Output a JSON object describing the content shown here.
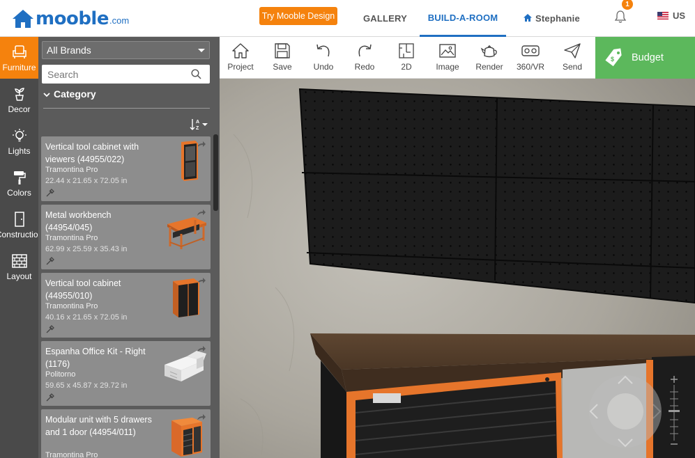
{
  "header": {
    "logo_text": "mooble",
    "logo_suffix": ".com",
    "try_button": "Try Mooble Design",
    "nav": {
      "gallery": "GALLERY",
      "build": "BUILD-A-ROOM",
      "user": "Stephanie"
    },
    "notifications_count": "1",
    "language": "US"
  },
  "sidebar": {
    "items": [
      {
        "label": "Furniture",
        "icon": "armchair-icon",
        "active": true
      },
      {
        "label": "Decor",
        "icon": "plant-icon"
      },
      {
        "label": "Lights",
        "icon": "bulb-icon"
      },
      {
        "label": "Colors",
        "icon": "paint-roller-icon"
      },
      {
        "label": "Construction",
        "icon": "door-icon"
      },
      {
        "label": "Layout",
        "icon": "brick-wall-icon"
      }
    ]
  },
  "catalog": {
    "brand_filter": "All Brands",
    "search_placeholder": "Search",
    "category_label": "Category",
    "items": [
      {
        "title": "Vertical tool cabinet with viewers (44955/022)",
        "brand": "Tramontina Pro",
        "dims": "22.44 x 21.65 x 72.05 in"
      },
      {
        "title": "Metal workbench (44954/045)",
        "brand": "Tramontina Pro",
        "dims": "62.99 x 25.59 x 35.43 in"
      },
      {
        "title": "Vertical tool cabinet (44955/010)",
        "brand": "Tramontina Pro",
        "dims": "40.16 x 21.65 x 72.05 in"
      },
      {
        "title": "Espanha Office Kit - Right (1176)",
        "brand": "Politorno",
        "dims": "59.65 x 45.87 x 29.72 in"
      },
      {
        "title": "Modular unit with 5 drawers and 1 door (44954/011)",
        "brand": "Tramontina Pro",
        "dims": ""
      }
    ]
  },
  "toolbar": {
    "project": "Project",
    "save": "Save",
    "undo": "Undo",
    "redo": "Redo",
    "two_d": "2D",
    "image": "Image",
    "render": "Render",
    "vr": "360/VR",
    "send": "Send",
    "budget": "Budget"
  },
  "colors": {
    "brand_blue": "#1f6fc2",
    "accent_orange": "#f5820d",
    "budget_green": "#5cb85c",
    "panel_gray": "#5b5b5b",
    "iconbar_gray": "#4a4a4a"
  }
}
